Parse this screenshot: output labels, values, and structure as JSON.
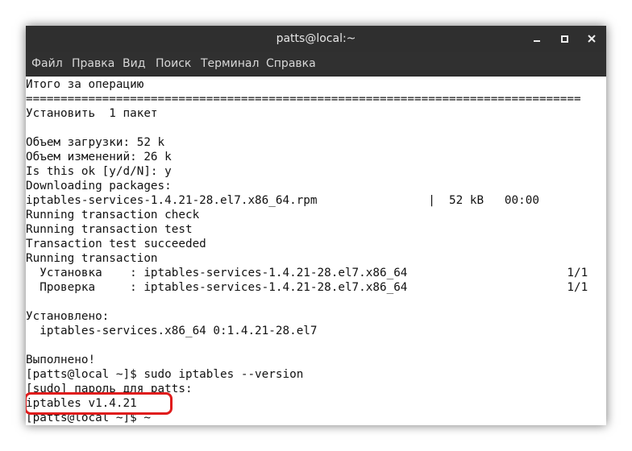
{
  "window": {
    "title": "patts@local:~"
  },
  "menubar": {
    "items": [
      "Файл",
      "Правка",
      "Вид",
      "Поиск",
      "Терминал",
      "Справка"
    ]
  },
  "icons": {
    "minimize": "minimize-icon",
    "maximize": "maximize-icon",
    "close": "close-icon"
  },
  "terminal": {
    "lines": [
      "Итого за операцию",
      "================================================================================",
      "Установить  1 пакет",
      "",
      "Объем загрузки: 52 k",
      "Объем изменений: 26 k",
      "Is this ok [y/d/N]: y",
      "Downloading packages:",
      "iptables-services-1.4.21-28.el7.x86_64.rpm                |  52 kB   00:00",
      "Running transaction check",
      "Running transaction test",
      "Transaction test succeeded",
      "Running transaction",
      "  Установка    : iptables-services-1.4.21-28.el7.x86_64                       1/1",
      "  Проверка     : iptables-services-1.4.21-28.el7.x86_64                       1/1",
      "",
      "Установлено:",
      "  iptables-services.x86_64 0:1.4.21-28.el7",
      "",
      "Выполнено!",
      "[patts@local ~]$ sudo iptables --version",
      "[sudo] пароль для patts:",
      "iptables v1.4.21",
      "[patts@local ~]$ ~"
    ]
  },
  "colors": {
    "highlight": "#e01b1b",
    "titlebar": "#2f2f2f",
    "terminal_bg": "#ffffff"
  }
}
